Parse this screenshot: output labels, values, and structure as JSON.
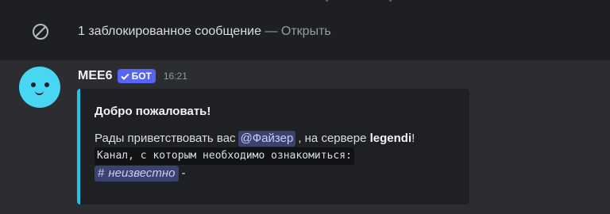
{
  "blocked": {
    "icon": "blocked-icon",
    "text": "1 заблокированное сообщение",
    "separator": "—",
    "action": "Открыть"
  },
  "message": {
    "avatar_icon": "mee6-avatar",
    "username": "MEE6",
    "bot_badge": "БОТ",
    "timestamp": "16:21",
    "embed": {
      "accent_color": "#22c3e6",
      "title": "Добро пожаловать!",
      "desc_prefix": "Рады приветствовать вас",
      "mention": "@Файзер",
      "desc_middle": ", на сервере",
      "server_name": "legendi",
      "desc_suffix": "!",
      "code_text": "Канал, с которым необходимо ознакомиться:",
      "channel_name": "неизвестно",
      "channel_hash": "#",
      "trailing": "-"
    }
  }
}
